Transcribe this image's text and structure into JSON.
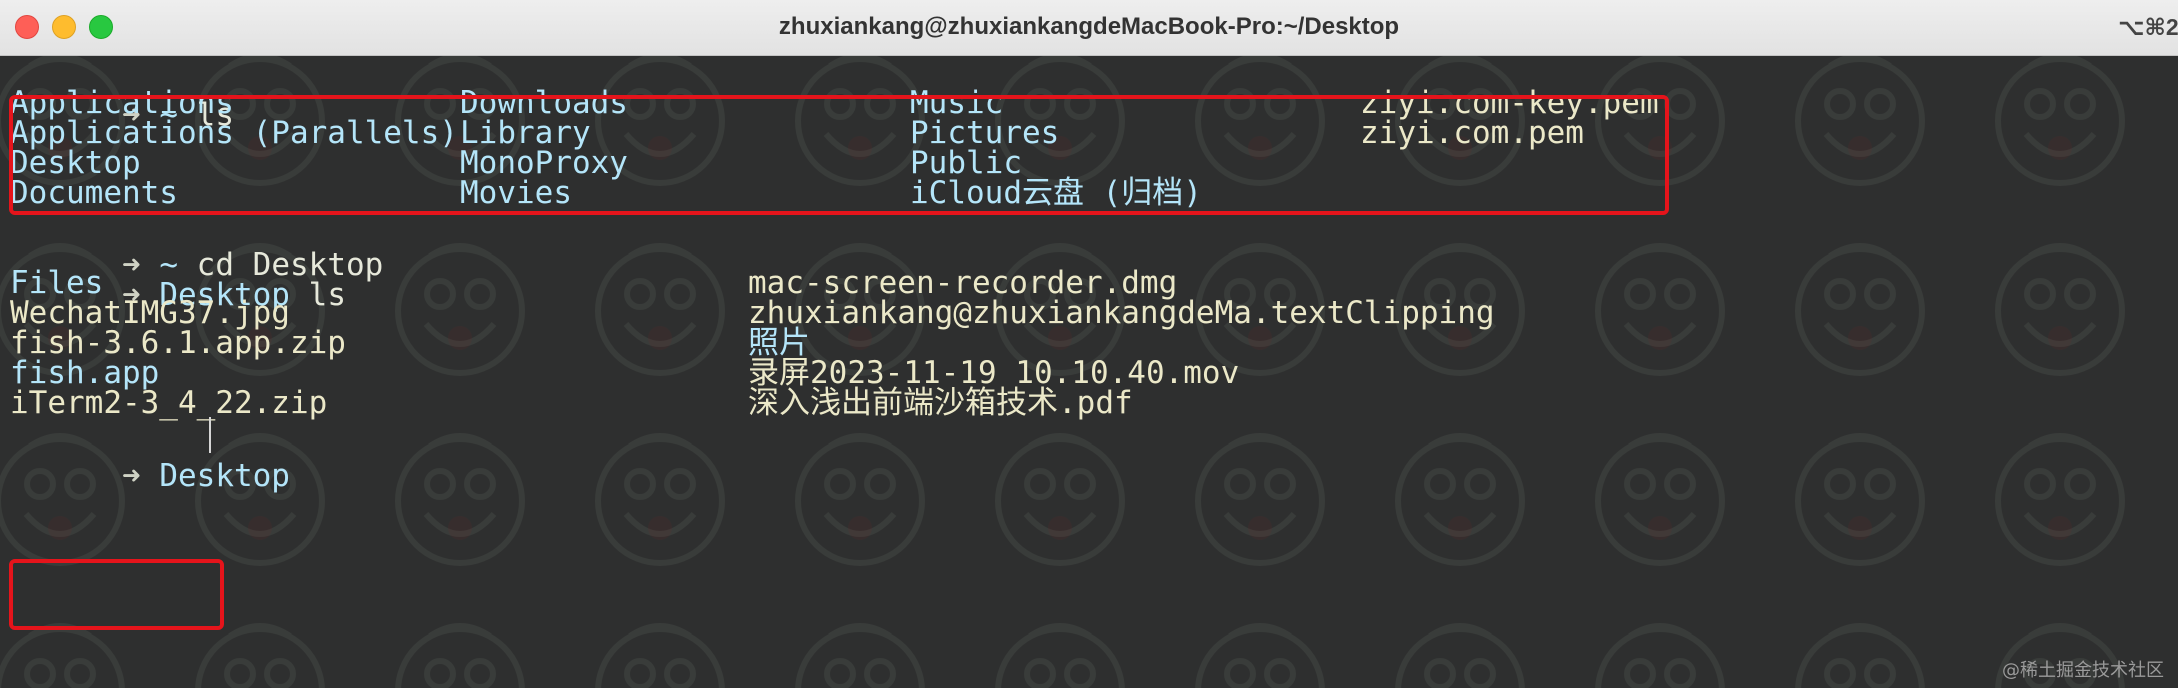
{
  "window": {
    "title": "zhuxiankang@zhuxiankangdeMacBook-Pro:~/Desktop",
    "shortcut": "⌥⌘2"
  },
  "colors": {
    "directory": "#b4e5f9",
    "file": "#ebe8c8",
    "prompt_arrow": "#cfd2c4",
    "highlight_border": "#e5141b",
    "background": "#2e2f2f"
  },
  "terminal": {
    "prompt_arrow": "➜",
    "cmd1": {
      "cwd": "~",
      "command": "ls"
    },
    "home_listing": {
      "col1": [
        "Applications",
        "Applications (Parallels)",
        "Desktop",
        "Documents"
      ],
      "col2": [
        "Downloads",
        "Library",
        "MonoProxy",
        "Movies"
      ],
      "col3": [
        "Music",
        "Pictures",
        "Public",
        "iCloud云盘 (归档)"
      ],
      "col4": [
        "ziyi.com-key.pem",
        "ziyi.com.pem"
      ]
    },
    "cmd2": {
      "cwd": "~",
      "command": "cd Desktop"
    },
    "cmd3": {
      "cwd": "Desktop",
      "command": "ls"
    },
    "desktop_listing": {
      "col1": [
        "Files",
        "WechatIMG37.jpg",
        "fish-3.6.1.app.zip",
        "fish.app",
        "iTerm2-3_4_22.zip"
      ],
      "col2": [
        "mac-screen-recorder.dmg",
        "zhuxiankang@zhuxiankangdeMa.textClipping",
        "照片",
        "录屏2023-11-19 10.10.40.mov",
        "深入浅出前端沙箱技术.pdf"
      ]
    },
    "current_prompt": {
      "cwd": "Desktop"
    }
  },
  "watermark": "@稀土掘金技术社区"
}
